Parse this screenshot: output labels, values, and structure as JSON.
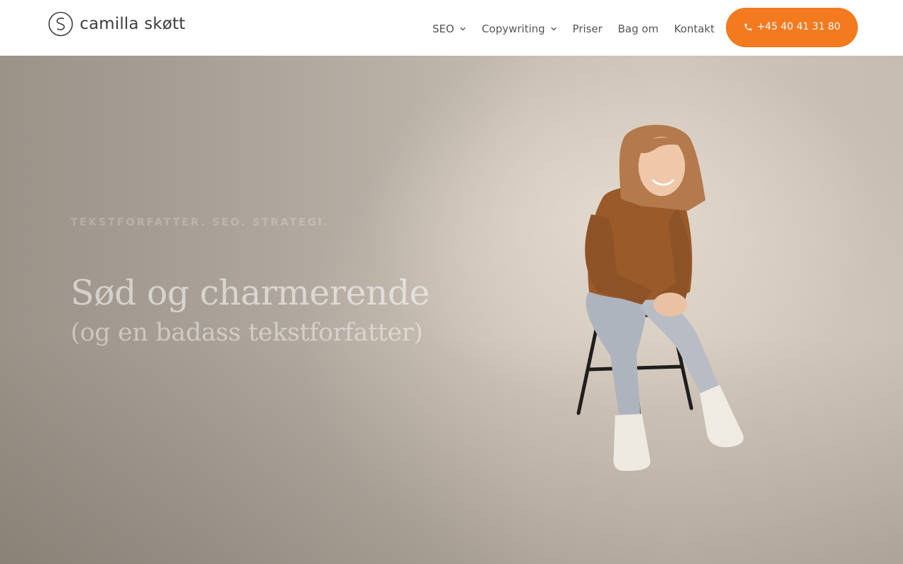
{
  "header": {
    "logo_text": "camilla skøtt",
    "nav": [
      {
        "label": "SEO",
        "has_dropdown": true
      },
      {
        "label": "Copywriting",
        "has_dropdown": true
      },
      {
        "label": "Priser",
        "has_dropdown": false
      },
      {
        "label": "Bag om",
        "has_dropdown": false
      },
      {
        "label": "Kontakt",
        "has_dropdown": false
      }
    ],
    "cta": {
      "label": "+45 40 41 31 80",
      "icon": "phone-icon",
      "color": "#f47a20"
    }
  },
  "hero": {
    "eyebrow": "TEKSTFORFATTER. SEO. STRATEGI.",
    "headline": "Sød og charmerende",
    "subheadline": "(og en badass tekstforfatter)"
  },
  "colors": {
    "accent": "#f47a20",
    "nav_text": "#555555",
    "logo_text": "#3d3d3d",
    "hero_background": "#b7ada2"
  }
}
